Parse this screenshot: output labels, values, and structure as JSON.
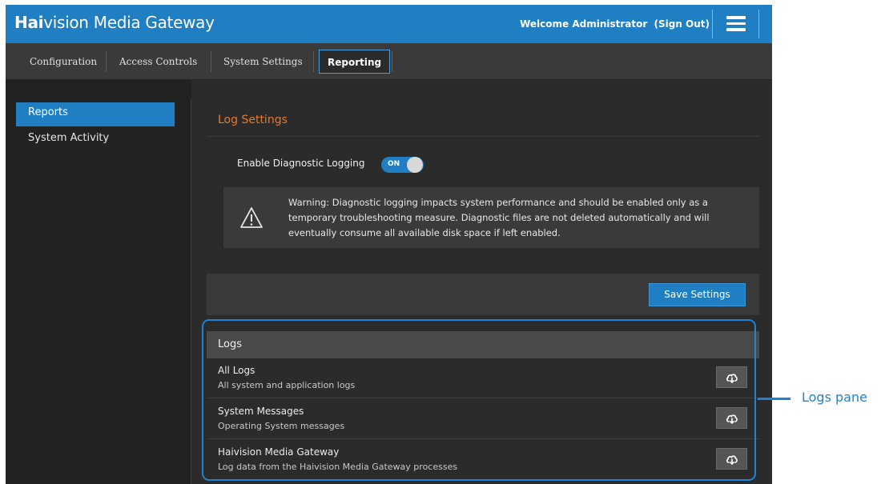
{
  "header": {
    "brand_bold": "Hai",
    "brand_rest": "vision Media Gateway",
    "welcome": "Welcome Administrator",
    "signout": "(Sign Out)"
  },
  "nav": {
    "tabs": [
      {
        "label": "Configuration"
      },
      {
        "label": "Access Controls"
      },
      {
        "label": "System Settings"
      },
      {
        "label": "Reporting",
        "active": true
      }
    ]
  },
  "sidebar": {
    "items": [
      {
        "label": "Reports",
        "active": true
      },
      {
        "label": "System Activity"
      }
    ]
  },
  "log_settings": {
    "title": "Log Settings",
    "diagnostic_label": "Enable Diagnostic Logging",
    "toggle_state": "ON",
    "warning_text": "Warning: Diagnostic logging impacts system performance and should be enabled only as a temporary troubleshooting measure. Diagnostic files are not deleted automatically and will eventually consume all available disk space if left enabled.",
    "save_label": "Save Settings"
  },
  "logs": {
    "title": "Logs",
    "rows": [
      {
        "name": "All Logs",
        "desc": "All system and application logs"
      },
      {
        "name": "System Messages",
        "desc": "Operating System messages"
      },
      {
        "name": "Haivision Media Gateway",
        "desc": "Log data from the Haivision Media Gateway processes"
      }
    ]
  },
  "annotation": {
    "label": "Logs pane"
  },
  "icons": {
    "menu": "hamburger-menu-icon",
    "warning": "warning-triangle-icon",
    "download": "cloud-download-icon"
  },
  "colors": {
    "accent": "#1f7fc2",
    "section_title": "#e8792a",
    "callout": "#1c84d4"
  }
}
